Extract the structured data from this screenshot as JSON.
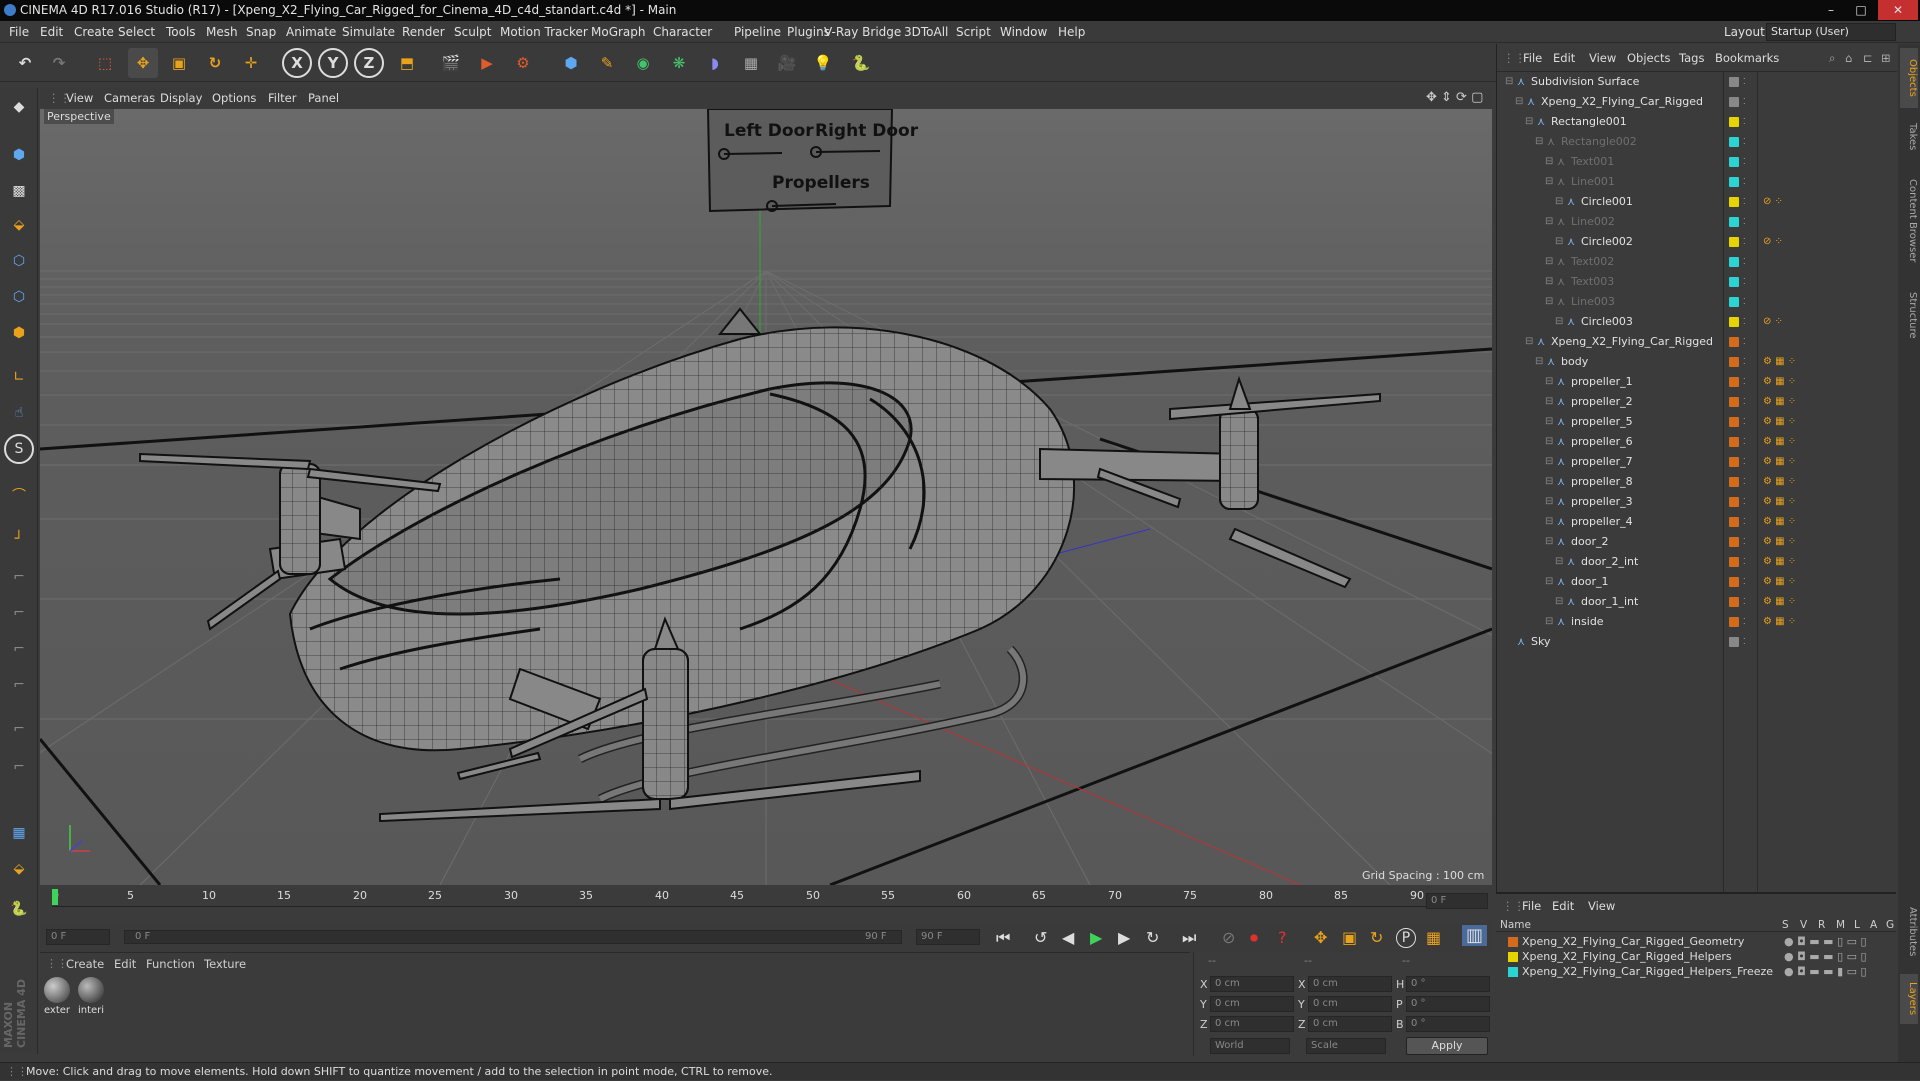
{
  "window": {
    "title": "CINEMA 4D R17.016 Studio (R17) - [Xpeng_X2_Flying_Car_Rigged_for_Cinema_4D_c4d_standart.c4d *] - Main",
    "controls": [
      "–",
      "□",
      "✕"
    ]
  },
  "menubar": {
    "items": [
      "File",
      "Edit",
      "Create",
      "Select",
      "Tools",
      "Mesh",
      "Snap",
      "Animate",
      "Simulate",
      "Render",
      "Sculpt",
      "Motion Tracker",
      "MoGraph",
      "Character",
      "Pipeline",
      "Plugins",
      "V-Ray Bridge",
      "3DToAll",
      "Script",
      "Window",
      "Help"
    ],
    "layout_label": "Layout:",
    "layout_value": "Startup (User)"
  },
  "toolbar": {
    "axis_x": "X",
    "axis_y": "Y",
    "axis_z": "Z"
  },
  "lefttools": {
    "s_label": "S"
  },
  "viewport": {
    "menu": [
      "View",
      "Cameras",
      "Display",
      "Options",
      "Filter",
      "Panel"
    ],
    "label": "Perspective",
    "grid_spacing": "Grid Spacing : 100 cm",
    "sign": {
      "left_door": "Left Door",
      "right_door": "Right Door",
      "propellers": "Propellers"
    }
  },
  "timeline": {
    "ticks": [
      "0",
      "5",
      "10",
      "15",
      "20",
      "25",
      "30",
      "35",
      "40",
      "45",
      "50",
      "55",
      "60",
      "65",
      "70",
      "75",
      "80",
      "85",
      "90"
    ],
    "current_frame": "0 F",
    "start_field": "0 F",
    "range_start": "0 F",
    "range_end": "90 F",
    "end_field": "90 F"
  },
  "materials": {
    "menu": [
      "Create",
      "Edit",
      "Function",
      "Texture"
    ],
    "items": [
      {
        "label": "exter"
      },
      {
        "label": "interi"
      }
    ]
  },
  "coords": {
    "header_left": "--",
    "header_mid": "--",
    "header_right": "--",
    "rows": [
      {
        "a": "X",
        "av": "0 cm",
        "b": "X",
        "bv": "0 cm",
        "c": "H",
        "cv": "0 °"
      },
      {
        "a": "Y",
        "av": "0 cm",
        "b": "Y",
        "bv": "0 cm",
        "c": "P",
        "cv": "0 °"
      },
      {
        "a": "Z",
        "av": "0 cm",
        "b": "Z",
        "bv": "0 cm",
        "c": "B",
        "cv": "0 °"
      }
    ],
    "world": "World",
    "scale": "Scale",
    "apply": "Apply"
  },
  "objects": {
    "menu": [
      "File",
      "Edit",
      "View",
      "Objects",
      "Tags",
      "Bookmarks"
    ],
    "rows": [
      {
        "name": "Subdivision Surface",
        "indent": 0,
        "color": "#888",
        "dim": false
      },
      {
        "name": "Xpeng_X2_Flying_Car_Rigged",
        "indent": 1,
        "color": "#888",
        "dim": false
      },
      {
        "name": "Rectangle001",
        "indent": 2,
        "color": "#e6d400",
        "dim": false
      },
      {
        "name": "Rectangle002",
        "indent": 3,
        "color": "#2bd3d3",
        "dim": true
      },
      {
        "name": "Text001",
        "indent": 4,
        "color": "#2bd3d3",
        "dim": true
      },
      {
        "name": "Line001",
        "indent": 4,
        "color": "#2bd3d3",
        "dim": true
      },
      {
        "name": "Circle001",
        "indent": 5,
        "color": "#e6d400",
        "dim": false
      },
      {
        "name": "Line002",
        "indent": 4,
        "color": "#2bd3d3",
        "dim": true
      },
      {
        "name": "Circle002",
        "indent": 5,
        "color": "#e6d400",
        "dim": false
      },
      {
        "name": "Text002",
        "indent": 4,
        "color": "#2bd3d3",
        "dim": true
      },
      {
        "name": "Text003",
        "indent": 4,
        "color": "#2bd3d3",
        "dim": true
      },
      {
        "name": "Line003",
        "indent": 4,
        "color": "#2bd3d3",
        "dim": true
      },
      {
        "name": "Circle003",
        "indent": 5,
        "color": "#e6d400",
        "dim": false
      },
      {
        "name": "Xpeng_X2_Flying_Car_Rigged",
        "indent": 2,
        "color": "#d36a1c",
        "dim": false
      },
      {
        "name": "body",
        "indent": 3,
        "color": "#d36a1c",
        "dim": false
      },
      {
        "name": "propeller_1",
        "indent": 4,
        "color": "#d36a1c",
        "dim": false
      },
      {
        "name": "propeller_2",
        "indent": 4,
        "color": "#d36a1c",
        "dim": false
      },
      {
        "name": "propeller_5",
        "indent": 4,
        "color": "#d36a1c",
        "dim": false
      },
      {
        "name": "propeller_6",
        "indent": 4,
        "color": "#d36a1c",
        "dim": false
      },
      {
        "name": "propeller_7",
        "indent": 4,
        "color": "#d36a1c",
        "dim": false
      },
      {
        "name": "propeller_8",
        "indent": 4,
        "color": "#d36a1c",
        "dim": false
      },
      {
        "name": "propeller_3",
        "indent": 4,
        "color": "#d36a1c",
        "dim": false
      },
      {
        "name": "propeller_4",
        "indent": 4,
        "color": "#d36a1c",
        "dim": false
      },
      {
        "name": "door_2",
        "indent": 4,
        "color": "#d36a1c",
        "dim": false
      },
      {
        "name": "door_2_int",
        "indent": 5,
        "color": "#d36a1c",
        "dim": false
      },
      {
        "name": "door_1",
        "indent": 4,
        "color": "#d36a1c",
        "dim": false
      },
      {
        "name": "door_1_int",
        "indent": 5,
        "color": "#d36a1c",
        "dim": false
      },
      {
        "name": "inside",
        "indent": 4,
        "color": "#d36a1c",
        "dim": false
      },
      {
        "name": "Sky",
        "indent": 0,
        "color": "#888",
        "dim": false
      }
    ]
  },
  "layers": {
    "menu": [
      "File",
      "Edit",
      "View"
    ],
    "header": {
      "name": "Name",
      "cols": [
        "S",
        "V",
        "R",
        "M",
        "L",
        "A",
        "G"
      ]
    },
    "rows": [
      {
        "name": "Xpeng_X2_Flying_Car_Rigged_Geometry",
        "color": "#d36a1c"
      },
      {
        "name": "Xpeng_X2_Flying_Car_Rigged_Helpers",
        "color": "#e6d400"
      },
      {
        "name": "Xpeng_X2_Flying_Car_Rigged_Helpers_Freeze",
        "color": "#2bd3d3"
      }
    ]
  },
  "righttabs": [
    "Objects",
    "Takes",
    "Content Browser",
    "Structure",
    "Attributes",
    "Layers"
  ],
  "status": "Move: Click and drag to move elements. Hold down SHIFT to quantize movement / add to the selection in point mode, CTRL to remove."
}
